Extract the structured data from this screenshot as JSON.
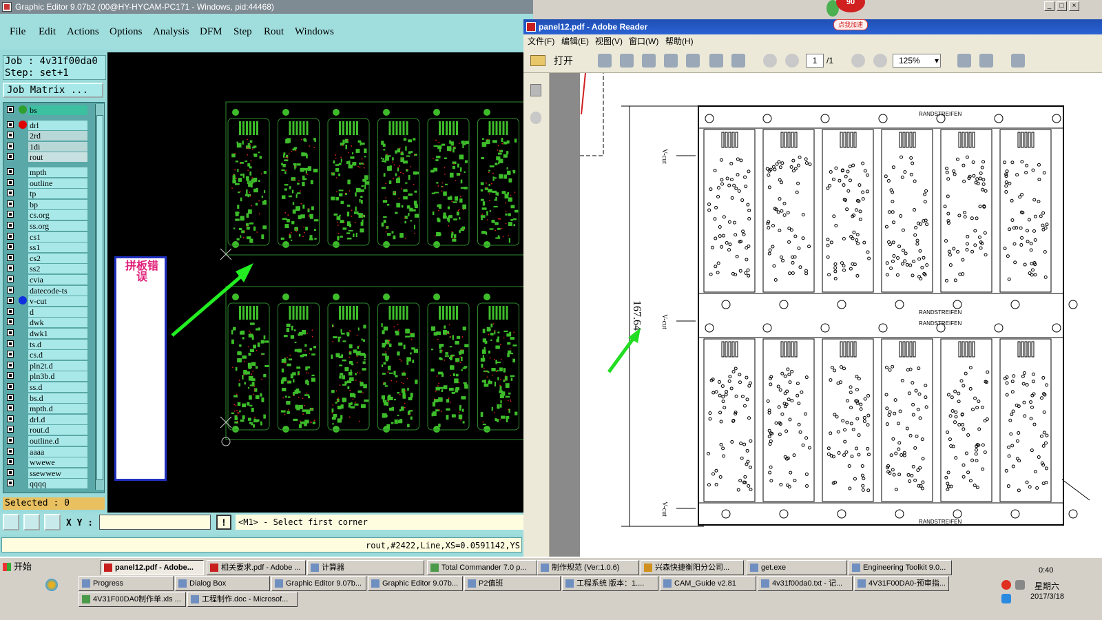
{
  "graphic_editor": {
    "title": "Graphic Editor 9.07b2 (00@HY-HYCAM-PC171 - Windows, pid:44468)",
    "menu": [
      "File",
      "Edit",
      "Actions",
      "Options",
      "Analysis",
      "DFM",
      "Step",
      "Rout",
      "Windows"
    ],
    "job": "Job : 4v31f00da0",
    "step": "Step: set+1",
    "job_matrix": "Job Matrix ...",
    "layers": [
      {
        "name": "bs",
        "dot": "#2ea02e"
      },
      {
        "name": "drl",
        "dot": "#e00000"
      },
      {
        "name": "2rd",
        "dot": ""
      },
      {
        "name": "1di",
        "dot": ""
      },
      {
        "name": "rout",
        "dot": ""
      },
      {
        "name": "mpth",
        "dot": ""
      },
      {
        "name": "outline",
        "dot": ""
      },
      {
        "name": "tp",
        "dot": ""
      },
      {
        "name": "bp",
        "dot": ""
      },
      {
        "name": "cs.org",
        "dot": ""
      },
      {
        "name": "ss.org",
        "dot": ""
      },
      {
        "name": "cs1",
        "dot": ""
      },
      {
        "name": "ss1",
        "dot": ""
      },
      {
        "name": "cs2",
        "dot": ""
      },
      {
        "name": "ss2",
        "dot": ""
      },
      {
        "name": "cvia",
        "dot": ""
      },
      {
        "name": "datecode-ts",
        "dot": ""
      },
      {
        "name": "v-cut",
        "dot": "#1030e0"
      },
      {
        "name": "d",
        "dot": ""
      },
      {
        "name": "dwk",
        "dot": ""
      },
      {
        "name": "dwk1",
        "dot": ""
      },
      {
        "name": "ts.d",
        "dot": ""
      },
      {
        "name": "cs.d",
        "dot": ""
      },
      {
        "name": "pln2t.d",
        "dot": ""
      },
      {
        "name": "pln3b.d",
        "dot": ""
      },
      {
        "name": "ss.d",
        "dot": ""
      },
      {
        "name": "bs.d",
        "dot": ""
      },
      {
        "name": "mpth.d",
        "dot": ""
      },
      {
        "name": "drl.d",
        "dot": ""
      },
      {
        "name": "rout.d",
        "dot": ""
      },
      {
        "name": "outline.d",
        "dot": ""
      },
      {
        "name": "aaaa",
        "dot": ""
      },
      {
        "name": "wwewe",
        "dot": ""
      },
      {
        "name": "ssewwew",
        "dot": ""
      },
      {
        "name": "qqqq",
        "dot": ""
      }
    ],
    "selected": "Selected : 0",
    "xy_label": "X Y :",
    "xy_value": "",
    "prompt": "<M1> - Select first corner",
    "status": "rout,#2422,Line,XS=0.0591142,YS",
    "note_text": "拼板错误",
    "colors": {
      "board": "#2e8b2e",
      "pad": "#3dbd2a",
      "drill": "#e02020",
      "arrow": "#22ee22"
    }
  },
  "reader": {
    "title": "panel12.pdf - Adobe Reader",
    "menu": [
      "文件(F)",
      "编辑(E)",
      "视图(V)",
      "窗口(W)",
      "帮助(H)"
    ],
    "open_label": "打开",
    "page_current": "1",
    "page_count": "/1",
    "zoom": "125%",
    "drawing": {
      "dimension": "167.64",
      "rail_label": "RANDSTREIFEN",
      "vcut_label": "V-cut"
    }
  },
  "badge": {
    "count": "90",
    "label": "点我加速"
  },
  "taskbar": {
    "start": "开始",
    "row1": [
      {
        "label": "panel12.pdf - Adobe...",
        "icon": "pdf",
        "active": true
      },
      {
        "label": "相关要求.pdf - Adobe ...",
        "icon": "pdf"
      },
      {
        "label": "计算器",
        "icon": "calc"
      },
      {
        "label": "Total Commander 7.0 p...",
        "icon": "tc"
      },
      {
        "label": "制作规范 (Ver:1.0.6)",
        "icon": "doc"
      },
      {
        "label": "兴森快捷衡阳分公司...",
        "icon": "star"
      },
      {
        "label": "get.exe",
        "icon": "app"
      },
      {
        "label": "Engineering Toolkit 9.0...",
        "icon": "app"
      }
    ],
    "row2": [
      {
        "label": "Progress",
        "icon": "app"
      },
      {
        "label": "Dialog Box",
        "icon": "app"
      },
      {
        "label": "Graphic Editor 9.07b...",
        "icon": "app"
      },
      {
        "label": "Graphic Editor 9.07b...",
        "icon": "app"
      },
      {
        "label": "P2值班",
        "icon": "app"
      },
      {
        "label": "工程系统   版本：1....",
        "icon": "app"
      },
      {
        "label": "CAM_Guide v2.81",
        "icon": "app"
      },
      {
        "label": "4v31f00da0.txt - 记...",
        "icon": "doc"
      },
      {
        "label": "4V31F00DA0-预审指...",
        "icon": "app"
      }
    ],
    "row3": [
      {
        "label": "4V31F00DA0制作单.xls ...",
        "icon": "xls"
      },
      {
        "label": "工程制作.doc - Microsof...",
        "icon": "doc"
      }
    ],
    "clock_time": "0:40",
    "clock_day": "星期六",
    "clock_date": "2017/3/18"
  }
}
